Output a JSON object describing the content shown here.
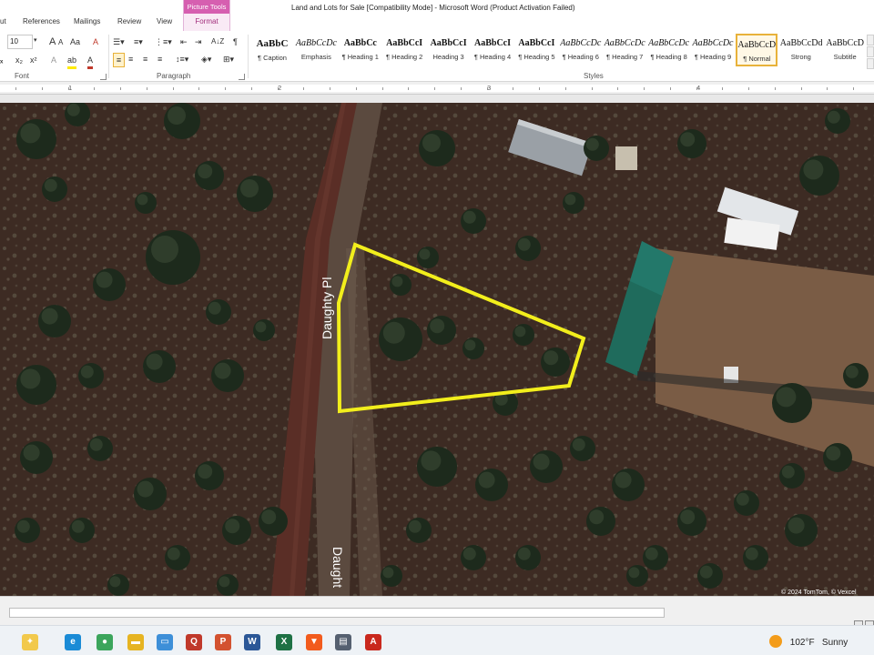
{
  "window": {
    "title": "Land and Lots for Sale [Compatibility Mode]  -  Microsoft Word (Product Activation Failed)"
  },
  "ribbon_tabs": {
    "layout_partial": "ut",
    "references": "References",
    "mailings": "Mailings",
    "review": "Review",
    "view": "View",
    "context_group": "Picture Tools",
    "format": "Format"
  },
  "font_group": {
    "font_size": "10",
    "label": "Font",
    "grow": "A",
    "shrink": "A",
    "change_case": "Aa",
    "clear_format": "A",
    "highlight": "ab",
    "font_color": "A"
  },
  "paragraph_group": {
    "label": "Paragraph",
    "sort": "A↓Z",
    "pilcrow": "¶"
  },
  "styles_group": {
    "label": "Styles",
    "tiles": [
      {
        "sample": "AaBbC",
        "name": "¶ Caption"
      },
      {
        "sample": "AaBbCcDc",
        "name": "Emphasis"
      },
      {
        "sample": "AaBbCc",
        "name": "¶ Heading 1"
      },
      {
        "sample": "AaBbCcI",
        "name": "¶ Heading 2"
      },
      {
        "sample": "AaBbCcI",
        "name": "Heading 3"
      },
      {
        "sample": "AaBbCcI",
        "name": "¶ Heading 4"
      },
      {
        "sample": "AaBbCcI",
        "name": "¶ Heading 5"
      },
      {
        "sample": "AaBbCcDc",
        "name": "¶ Heading 6"
      },
      {
        "sample": "AaBbCcDc",
        "name": "¶ Heading 7"
      },
      {
        "sample": "AaBbCcDc",
        "name": "¶ Heading 8"
      },
      {
        "sample": "AaBbCcDc",
        "name": "¶ Heading 9"
      },
      {
        "sample": "AaBbCcDc",
        "name": "¶ Normal",
        "selected": true
      },
      {
        "sample": "AaBbCcDd",
        "name": "Strong"
      },
      {
        "sample": "AaBbCcD",
        "name": "Subtitle"
      }
    ]
  },
  "ruler": {
    "numbers": [
      "1",
      "2",
      "3",
      "4"
    ]
  },
  "aerial_image": {
    "road_label_1": "Daughty Pl",
    "road_label_2": "Daught",
    "attribution": "© 2024 TomTom, © Vexcel",
    "colors": {
      "lot_outline": "#f2ee1c",
      "ground": "#3b2a22",
      "shrub": "#1d2a1c",
      "roof_green": "#1f6b5c"
    }
  },
  "taskbar": {
    "apps": [
      {
        "icon": "copilot-icon",
        "glyph": "✦",
        "color": "#f2c94c"
      },
      {
        "icon": "edge-icon",
        "glyph": "e",
        "color": "#1a8bd6"
      },
      {
        "icon": "chrome-icon",
        "glyph": "●",
        "color": "#3ba55c"
      },
      {
        "icon": "file-explorer-icon",
        "glyph": "▬",
        "color": "#e6b422"
      },
      {
        "icon": "photos-icon",
        "glyph": "▭",
        "color": "#3d8fd8"
      },
      {
        "icon": "access-icon",
        "glyph": "Q",
        "color": "#c0392b"
      },
      {
        "icon": "powerpoint-icon",
        "glyph": "P",
        "color": "#d35230"
      },
      {
        "icon": "word-icon",
        "glyph": "W",
        "color": "#2b5797"
      },
      {
        "icon": "excel-icon",
        "glyph": "X",
        "color": "#1e7145"
      },
      {
        "icon": "brave-icon",
        "glyph": "▼",
        "color": "#f25b1d"
      },
      {
        "icon": "printer-icon",
        "glyph": "▤",
        "color": "#556070"
      },
      {
        "icon": "acrobat-icon",
        "glyph": "A",
        "color": "#c9281d"
      }
    ],
    "weather_temp": "102°F",
    "weather_text": "Sunny"
  }
}
